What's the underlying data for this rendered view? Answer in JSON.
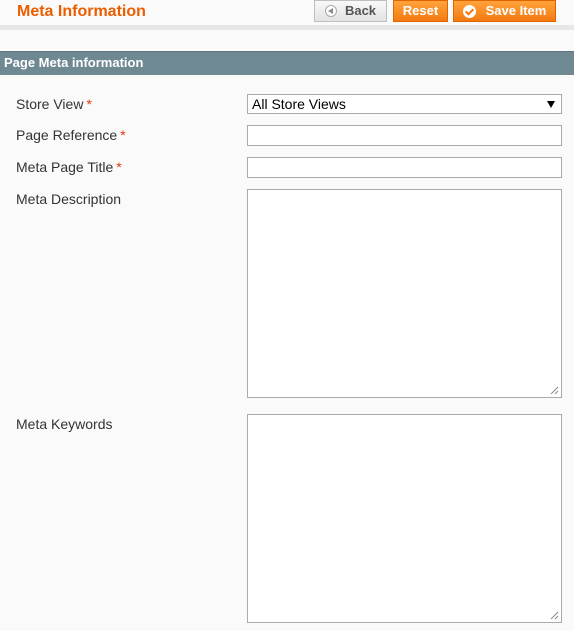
{
  "header": {
    "title": "Meta Information",
    "buttons": {
      "back": "Back",
      "reset": "Reset",
      "save": "Save Item"
    }
  },
  "section": {
    "title": "Page Meta information"
  },
  "fields": {
    "store_view": {
      "label": "Store View",
      "required_mark": "*",
      "selected": "All Store Views"
    },
    "page_reference": {
      "label": "Page Reference",
      "required_mark": "*",
      "value": ""
    },
    "meta_page_title": {
      "label": "Meta Page Title",
      "required_mark": "*",
      "value": ""
    },
    "meta_description": {
      "label": "Meta Description",
      "value": ""
    },
    "meta_keywords": {
      "label": "Meta Keywords",
      "value": ""
    }
  },
  "icons": {
    "back": "back-arrow-icon",
    "save": "checkmark-icon",
    "select": "dropdown-arrow-icon",
    "resize": "resize-grip-icon"
  },
  "colors": {
    "title": "#eb5e00",
    "accent_button": "#f47a12",
    "section_header": "#6f8992",
    "required": "#eb340a"
  }
}
